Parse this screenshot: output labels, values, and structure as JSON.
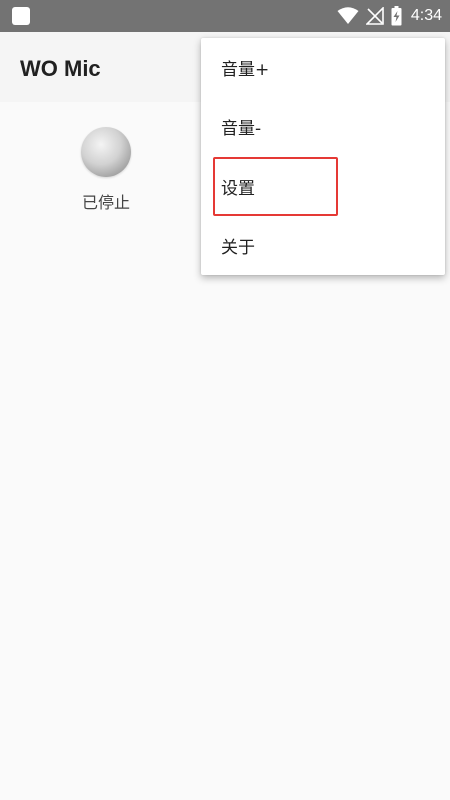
{
  "status_bar": {
    "time": "4:34",
    "icons": [
      "notification-square-icon",
      "wifi-icon",
      "no-signal-icon",
      "battery-charging-icon"
    ]
  },
  "app_bar": {
    "title": "WO Mic"
  },
  "main": {
    "connection_status": "已停止"
  },
  "menu": {
    "items": [
      {
        "label": "音量+"
      },
      {
        "label": "音量-"
      },
      {
        "label": "设置"
      },
      {
        "label": "关于"
      }
    ],
    "highlighted_item": "设置"
  },
  "colors": {
    "status_bar": "#737373",
    "app_bar": "#f5f5f5",
    "background": "#fafafa",
    "highlight": "#e53935"
  }
}
